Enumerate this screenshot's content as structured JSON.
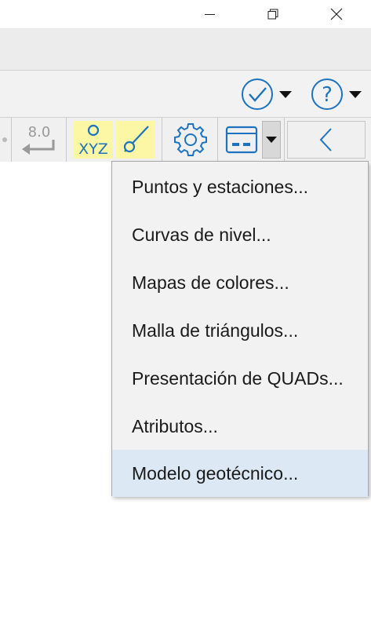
{
  "window": {
    "minimize_glyph": "—",
    "controls": [
      "minimize-icon",
      "restore-icon",
      "close-icon"
    ]
  },
  "quickbar": {
    "icons": [
      "check-circle-icon",
      "help-circle-icon"
    ],
    "help_glyph": "?"
  },
  "toolbar": {
    "enter_value_label": "8.0",
    "xyz_label": "XYZ",
    "tools": [
      "enter-value-icon",
      "xyz-points-icon",
      "line-tool-icon",
      "gear-icon",
      "layout-view-icon",
      "dropdown-arrow-icon",
      "chevron-left-icon"
    ]
  },
  "menu": {
    "items": [
      {
        "label": "Puntos y estaciones..."
      },
      {
        "label": "Curvas de nivel..."
      },
      {
        "label": "Mapas de colores..."
      },
      {
        "label": "Malla de triángulos..."
      },
      {
        "label": "Presentación de QUADs..."
      },
      {
        "label": "Atributos..."
      },
      {
        "label": "Modelo geotécnico..."
      }
    ],
    "highlighted_index": 6
  },
  "colors": {
    "accent": "#1e73be",
    "tool_highlight": "#fbf7a5",
    "menu_hover": "#dce8f4"
  }
}
